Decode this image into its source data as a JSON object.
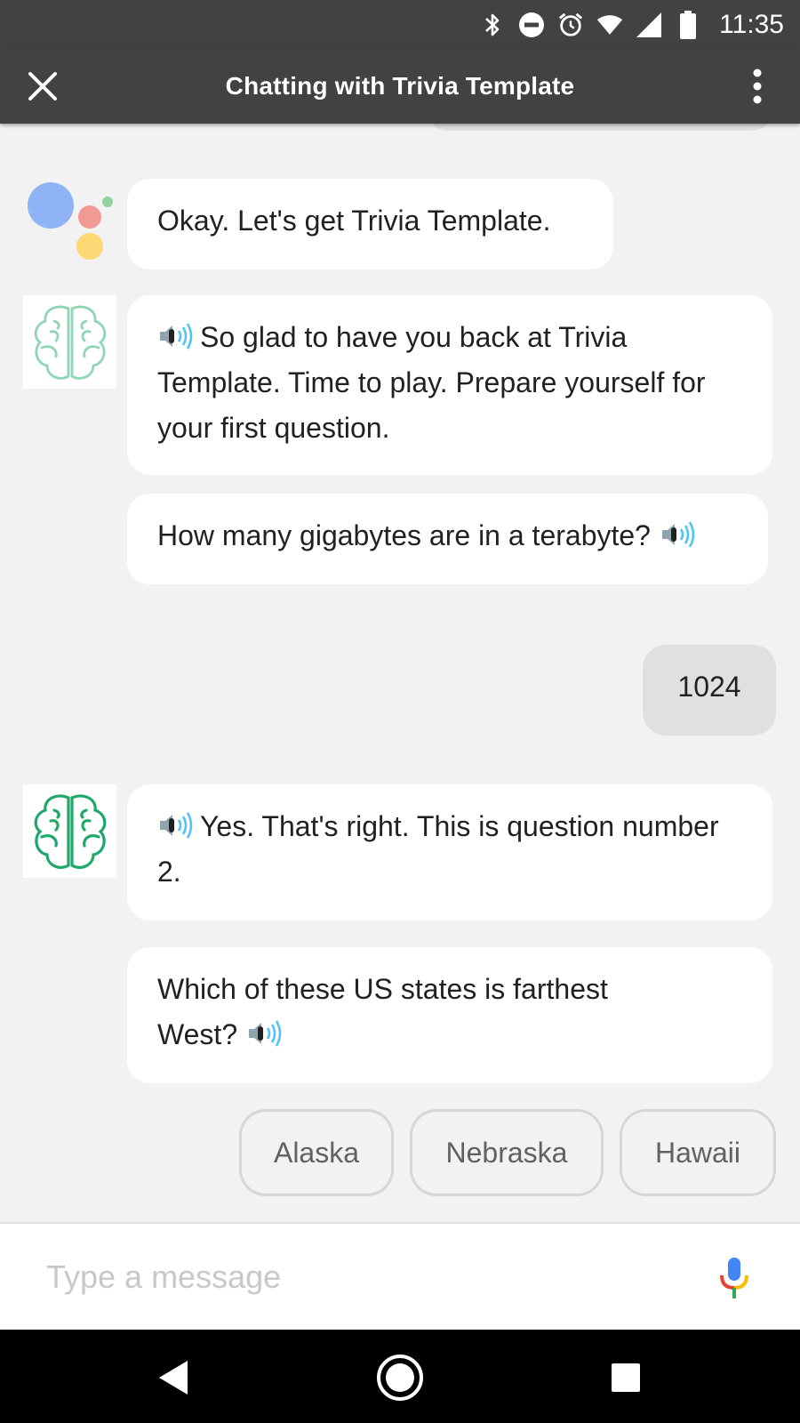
{
  "status_bar": {
    "time": "11:35",
    "icons": [
      "bluetooth-icon",
      "do-not-disturb-icon",
      "alarm-icon",
      "wifi-icon",
      "cell-signal-icon",
      "battery-icon"
    ]
  },
  "app_bar": {
    "title": "Chatting with Trivia Template",
    "icons": [
      "close-icon",
      "overflow-menu-icon"
    ]
  },
  "messages": [
    {
      "sender": "assistant",
      "text": "Okay. Let's get Trivia Template."
    },
    {
      "sender": "action",
      "text": "So glad to have you back at Trivia Template. Time to play. Prepare yourself for your first question."
    },
    {
      "sender": "action",
      "text": "How many gigabytes are in a terabyte?"
    },
    {
      "sender": "user",
      "text": "1024"
    },
    {
      "sender": "action",
      "text": "Yes. That's right. This is question number 2."
    },
    {
      "sender": "action",
      "text": "Which of these US states is farthest West?"
    }
  ],
  "suggestions": [
    "Alaska",
    "Nebraska",
    "Hawaii"
  ],
  "input": {
    "placeholder": "Type a message",
    "value": ""
  },
  "colors": {
    "app_bar": "#424242",
    "chat_bg": "#f2f2f2",
    "bubble": "#ffffff",
    "user_bubble": "#e0e0e0",
    "brain_light": "#8fd6b4",
    "brain_dark": "#1fa86a",
    "speaker_wave": "#4fc3f7"
  },
  "nav_bar": {
    "icons": [
      "back-icon",
      "home-icon",
      "recents-icon"
    ]
  }
}
